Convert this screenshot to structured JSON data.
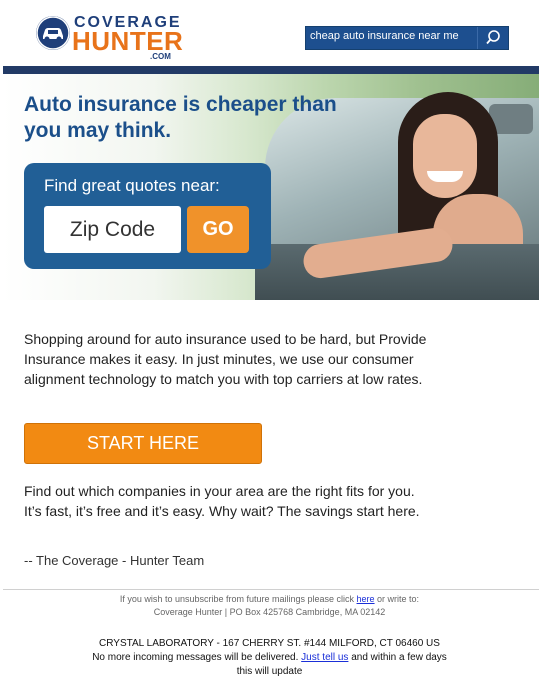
{
  "brand": {
    "logo_top": "COVERAGE",
    "logo_main": "HUNTER",
    "logo_suffix": ".COM"
  },
  "search": {
    "value": "cheap auto insurance near me"
  },
  "hero": {
    "title": "Auto insurance is cheaper than you may think.",
    "quote_label": "Find great quotes near:",
    "zip_placeholder": "Zip Code",
    "go_label": "GO"
  },
  "content": {
    "paragraph1": "Shopping around for auto insurance used to be hard, but Provide Insurance makes it easy. In just minutes, we use our consumer alignment technology to match you with top carriers at low rates.",
    "cta_label": "START HERE",
    "paragraph2": "Find out which companies in your area are the right fits for you. It’s fast, it’s free and it’s easy. Why wait? The savings start here.",
    "signoff": "--  The Coverage - Hunter Team"
  },
  "footer": {
    "unsub_prefix": "If you wish to unsubscribe from future mailings please click ",
    "unsub_link": "here",
    "unsub_suffix": " or write to:",
    "address_line": "Coverage Hunter | PO Box 425768 Cambridge, MA 02142",
    "lab_line": "CRYSTAL LABORATORY - 167 CHERRY ST. #144 MILFORD, CT 06460 US",
    "notice_prefix": "No more incoming messages will be delivered. ",
    "notice_link": "Just tell us",
    "notice_suffix": " and within a few days",
    "notice_line2": "this will update"
  },
  "colors": {
    "brand_blue": "#1f3f7a",
    "brand_orange": "#e8731a",
    "cta_orange": "#f28a12",
    "quote_box": "#215f96"
  },
  "icons": {
    "search": "search-icon",
    "logo": "car-logo-icon"
  }
}
